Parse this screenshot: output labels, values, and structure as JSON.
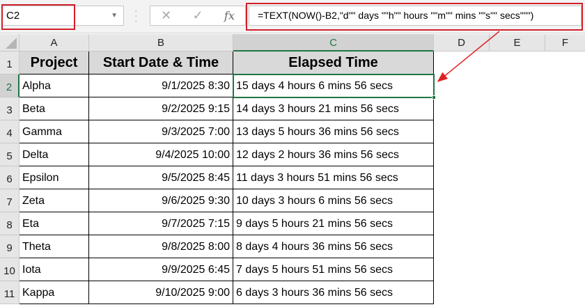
{
  "name_box": "C2",
  "formula": "=TEXT(NOW()-B2,\"d\"\" days \"\"h\"\" hours \"\"m\"\" mins \"\"s\"\" secs\"\"\")",
  "icons": {
    "cancel": "✕",
    "enter": "✓",
    "fx": "fx"
  },
  "columns": [
    "A",
    "B",
    "C",
    "D",
    "E",
    "F"
  ],
  "row_numbers": [
    "1",
    "2",
    "3",
    "4",
    "5",
    "6",
    "7",
    "8",
    "9",
    "10",
    "11"
  ],
  "headers": [
    "Project",
    "Start Date & Time",
    "Elapsed Time"
  ],
  "rows": [
    [
      "Alpha",
      "9/1/2025 8:30",
      "15 days 4 hours 6 mins 56 secs"
    ],
    [
      "Beta",
      "9/2/2025 9:15",
      "14 days 3 hours 21 mins 56 secs"
    ],
    [
      "Gamma",
      "9/3/2025 7:00",
      "13 days 5 hours 36 mins 56 secs"
    ],
    [
      "Delta",
      "9/4/2025 10:00",
      "12 days 2 hours 36 mins 56 secs"
    ],
    [
      "Epsilon",
      "9/5/2025 8:45",
      "11 days 3 hours 51 mins 56 secs"
    ],
    [
      "Zeta",
      "9/6/2025 9:30",
      "10 days 3 hours 6 mins 56 secs"
    ],
    [
      "Eta",
      "9/7/2025 7:15",
      "9 days 5 hours 21 mins 56 secs"
    ],
    [
      "Theta",
      "9/8/2025 8:00",
      "8 days 4 hours 36 mins 56 secs"
    ],
    [
      "Iota",
      "9/9/2025 6:45",
      "7 days 5 hours 51 mins 56 secs"
    ],
    [
      "Kappa",
      "9/10/2025 9:00",
      "6 days 3 hours 36 mins 56 secs"
    ]
  ],
  "colors": {
    "accent": "#217346",
    "annotation": "#d0202a"
  }
}
